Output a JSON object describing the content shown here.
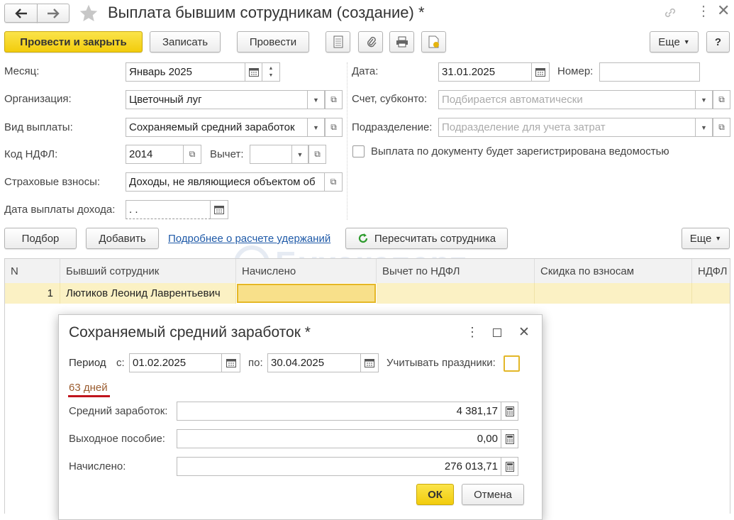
{
  "window": {
    "title": "Выплата бывшим сотрудникам (создание) *"
  },
  "toolbar": {
    "post_close": "Провести и закрыть",
    "save": "Записать",
    "post": "Провести",
    "more": "Еще",
    "help": "?"
  },
  "form": {
    "month_label": "Месяц:",
    "month_value": "Январь 2025",
    "org_label": "Организация:",
    "org_value": "Цветочный луг",
    "paytype_label": "Вид выплаты:",
    "paytype_value": "Сохраняемый средний заработок",
    "ndfl_label": "Код НДФЛ:",
    "ndfl_value": "2014",
    "deduction_label": "Вычет:",
    "deduction_value": "",
    "insurance_label": "Страховые взносы:",
    "insurance_value": "Доходы, не являющиеся объектом об",
    "paydate_label": "Дата выплаты дохода:",
    "paydate_value": " .  .",
    "date_label": "Дата:",
    "date_value": "31.01.2025",
    "number_label": "Номер:",
    "number_value": "",
    "account_label": "Счет, субконто:",
    "account_placeholder": "Подбирается автоматически",
    "dept_label": "Подразделение:",
    "dept_placeholder": "Подразделение для учета затрат",
    "statement_label": "Выплата по документу будет зарегистрирована ведомостью"
  },
  "table_toolbar": {
    "pick": "Подбор",
    "add": "Добавить",
    "link": "Подробнее о расчете удержаний",
    "recalc": "Пересчитать сотрудника",
    "more": "Еще"
  },
  "table": {
    "headers": [
      "N",
      "Бывший сотрудник",
      "Начислено",
      "Вычет по НДФЛ",
      "Скидка по взносам",
      "НДФЛ"
    ],
    "rows": [
      {
        "n": "1",
        "employee": "Лютиков Леонид Лаврентьевич",
        "accrued": "",
        "deduction": "",
        "discount": "",
        "ndfl": ""
      }
    ]
  },
  "watermark": "Бухэксперт",
  "dialog": {
    "title": "Сохраняемый средний заработок *",
    "period_label": "Период",
    "from_label": "с:",
    "from_value": "01.02.2025",
    "to_label": "по:",
    "to_value": "30.04.2025",
    "holidays_label": "Учитывать праздники:",
    "days": "63 дней",
    "avg_label": "Средний заработок:",
    "avg_value": "4 381,17",
    "severance_label": "Выходное пособие:",
    "severance_value": "0,00",
    "accrued_label": "Начислено:",
    "accrued_value": "276 013,71",
    "ok": "ОК",
    "cancel": "Отмена"
  },
  "colors": {
    "accent_yellow": "#f5d21a",
    "link": "#1f5aa8",
    "days_text": "#9a5b2e",
    "underline": "#c0141c"
  }
}
